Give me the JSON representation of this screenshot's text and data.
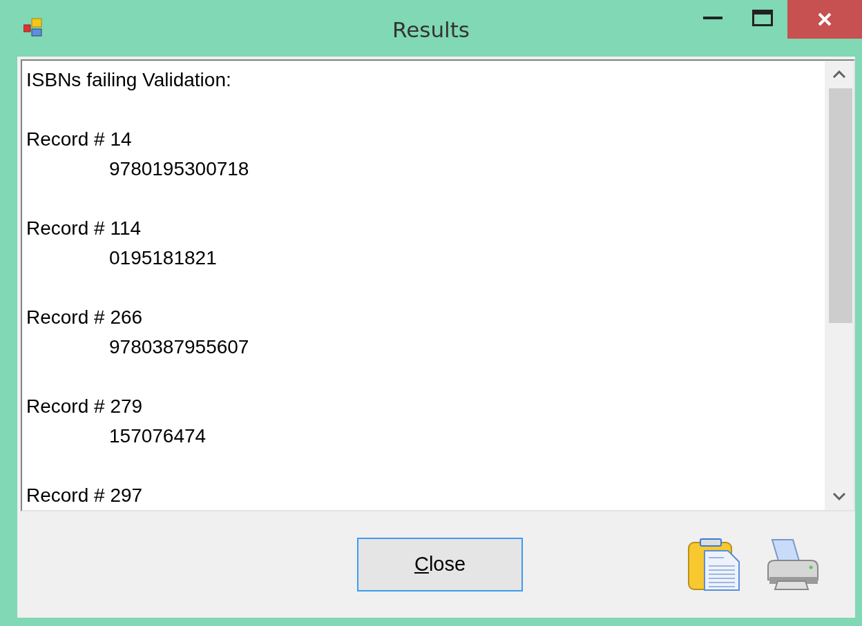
{
  "window": {
    "title": "Results"
  },
  "results": {
    "heading": "ISBNs failing Validation:",
    "records": [
      {
        "label": "Record # 14",
        "isbn": "9780195300718"
      },
      {
        "label": "Record # 114",
        "isbn": "0195181821"
      },
      {
        "label": "Record # 266",
        "isbn": "9780387955607"
      },
      {
        "label": "Record # 279",
        "isbn": "157076474"
      },
      {
        "label": "Record # 297"
      }
    ]
  },
  "buttons": [
    {
      "label": "Close",
      "mnemonic_underlined": true
    }
  ]
}
